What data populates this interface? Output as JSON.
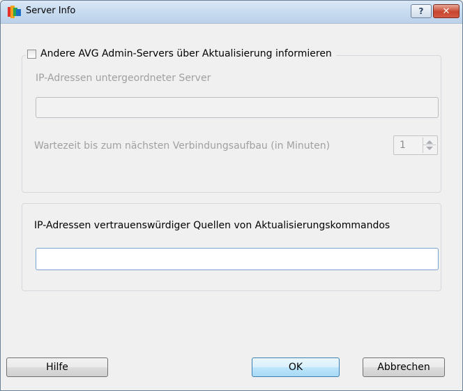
{
  "window": {
    "title": "Server Info",
    "icon": "avg-logo-icon",
    "help_button": "?",
    "close_button": "✕"
  },
  "forward_group": {
    "checkbox_label": "Andere AVG Admin-Servers über Aktualisierung informieren",
    "checked": false,
    "ip_label": "IP-Adressen untergeordneter Server",
    "ip_value": "",
    "wait_label": "Wartezeit bis zum nächsten Verbindungsaufbau (in Minuten)",
    "wait_value": "1"
  },
  "trusted_group": {
    "label": "IP-Adressen vertrauenswürdiger Quellen von Aktualisierungskommandos",
    "value": ""
  },
  "buttons": {
    "help": "Hilfe",
    "ok": "OK",
    "cancel": "Abbrechen"
  },
  "colors": {
    "titlebar": "#c9dcf0",
    "close": "#c7452f",
    "disabled_text": "#a0a0a0"
  }
}
